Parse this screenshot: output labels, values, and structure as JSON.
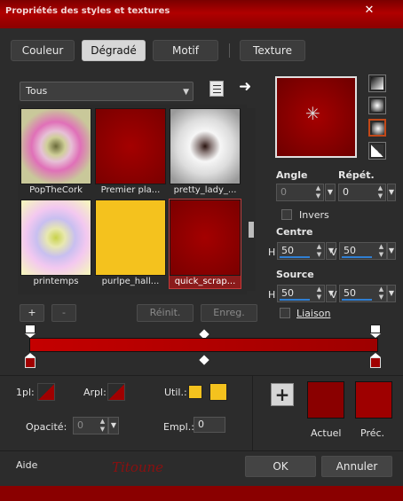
{
  "window": {
    "title": "Propriétés des styles et textures",
    "close_glyph": "✕"
  },
  "tabs": [
    {
      "label": "Couleur",
      "active": false
    },
    {
      "label": "Dégradé",
      "active": true
    },
    {
      "label": "Motif",
      "active": false
    },
    {
      "label": "Texture",
      "active": false
    }
  ],
  "gallery": {
    "category": "Tous",
    "items": [
      {
        "label": "PopTheCork",
        "selected": false
      },
      {
        "label": "Premier pla...",
        "selected": false
      },
      {
        "label": "pretty_lady_...",
        "selected": false
      },
      {
        "label": "printemps",
        "selected": false
      },
      {
        "label": "purlpe_hall...",
        "selected": false
      },
      {
        "label": "quick_scrap...",
        "selected": true
      }
    ],
    "add_label": "+",
    "remove_label": "-",
    "reset_label": "Réinit.",
    "save_label": "Enreg."
  },
  "options": {
    "angle_label": "Angle",
    "angle_value": "0",
    "repeat_label": "Répét.",
    "repeat_value": "0",
    "invert_label": "Invers",
    "invert_checked": false,
    "center_label": "Centre",
    "center_h_label": "H",
    "center_h_value": "50",
    "center_v_label": "V",
    "center_v_value": "50",
    "source_label": "Source",
    "source_h_label": "H",
    "source_h_value": "50",
    "source_v_label": "V",
    "source_v_value": "50",
    "link_label": "Liaison",
    "link_checked": false
  },
  "stops": {
    "first_label": "1pl:",
    "end_label": "Arpl:",
    "use_label": "Util.:",
    "opacity_label": "Opacité:",
    "opacity_value": "0",
    "location_label": "Empl.:",
    "location_value": "0",
    "add_stop_label": "+"
  },
  "current": {
    "label": "Actuel",
    "color": "#8a0000"
  },
  "previous": {
    "label": "Préc.",
    "color": "#9e0000"
  },
  "footer": {
    "help_label": "Aide",
    "watermark": "Titoune",
    "ok_label": "OK",
    "cancel_label": "Annuler"
  },
  "colors": {
    "accent": "#c40000",
    "dark_red": "#8a0000",
    "gold": "#f4c21e",
    "orange_outline": "#c24818"
  }
}
